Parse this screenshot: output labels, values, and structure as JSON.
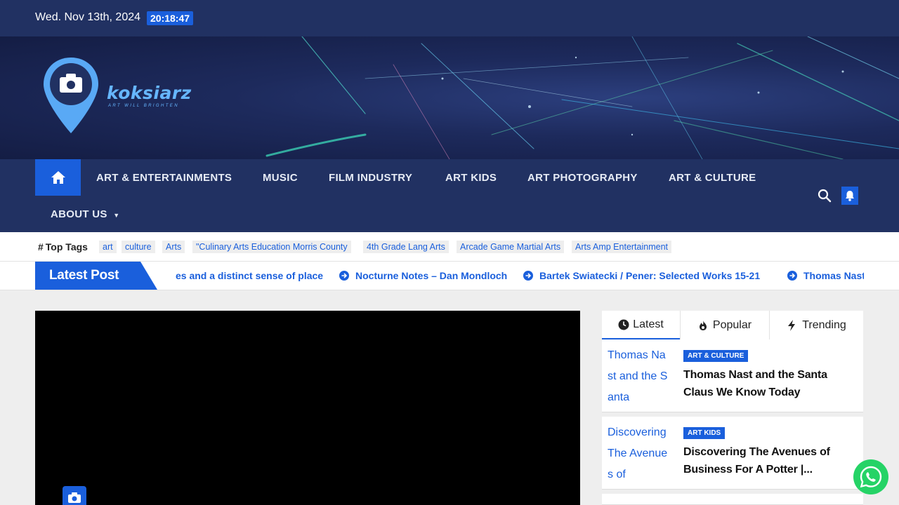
{
  "topbar": {
    "date": "Wed. Nov 13th, 2024",
    "time": "20:18:47"
  },
  "header": {
    "brand": "koksiarz",
    "tagline": "ART WILL BRIGHTEN"
  },
  "nav": {
    "items": [
      "ART & ENTERTAINMENTS",
      "MUSIC",
      "FILM INDUSTRY",
      "ART KIDS",
      "ART PHOTOGRAPHY",
      "ART & CULTURE"
    ],
    "about": "ABOUT US"
  },
  "tags": {
    "title": "Top Tags",
    "items": [
      "art",
      "culture",
      "Arts",
      "\"Culinary Arts Education Morris County",
      "4th Grade Lang Arts",
      "Arcade Game Martial Arts",
      "Arts Amp Entertainment"
    ]
  },
  "ticker": {
    "label": "Latest Post",
    "items": [
      "es and a distinct sense of place",
      "Nocturne Notes – Dan Mondloch",
      "Bartek Swiatecki / Pener: Selected Works 15-21",
      "Thomas Nast"
    ]
  },
  "sidebar": {
    "tabs": [
      "Latest",
      "Popular",
      "Trending"
    ],
    "posts": [
      {
        "thumb_alt": "Thomas Nast and the Santa",
        "category": "ART & CULTURE",
        "title": "Thomas Nast and the Santa Claus We Know Today"
      },
      {
        "thumb_alt": "Discovering The Avenues of",
        "category": "ART KIDS",
        "title": "Discovering The Avenues of Business For A Potter |..."
      }
    ]
  },
  "colors": {
    "navy": "#213162",
    "accent": "#1a5fdc",
    "whatsapp": "#25d366"
  }
}
